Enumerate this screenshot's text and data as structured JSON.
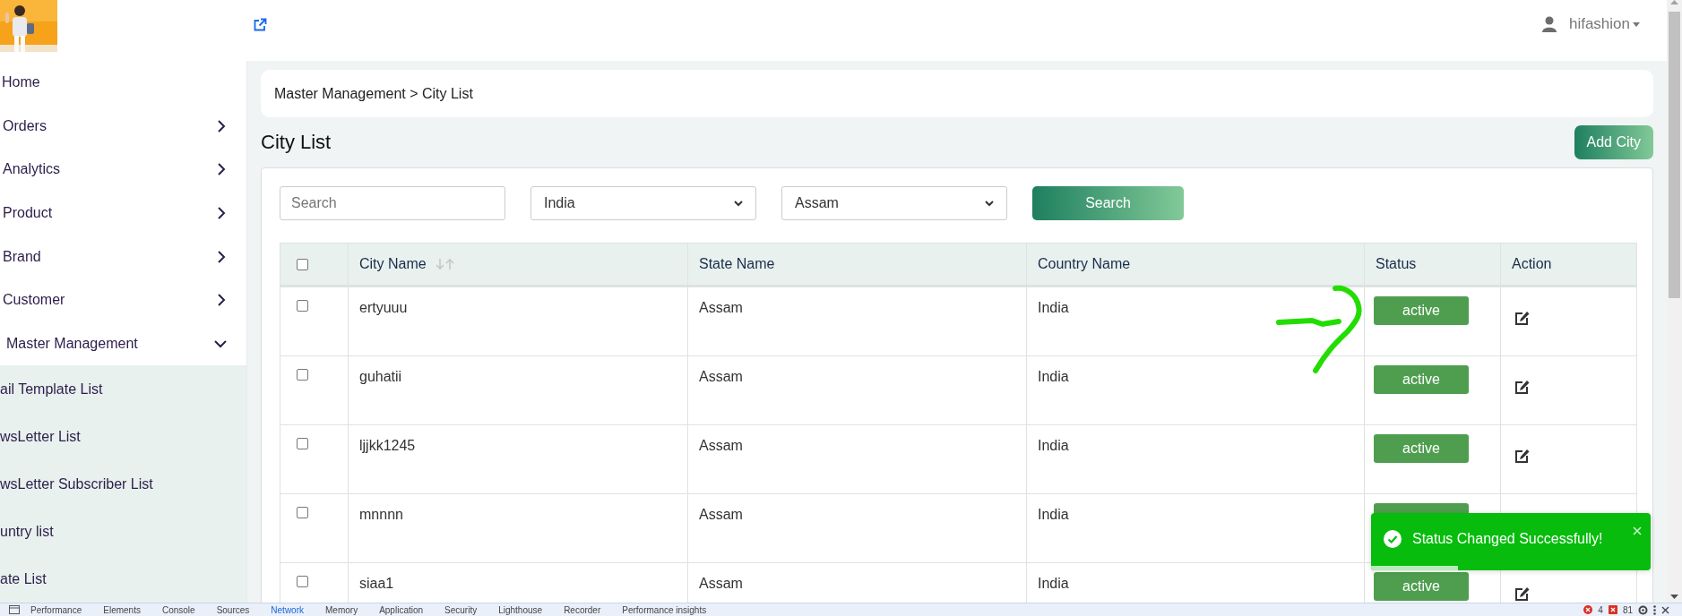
{
  "header": {
    "username": "hifashion"
  },
  "sidebar": {
    "items": [
      {
        "label": "Home",
        "kind": "link"
      },
      {
        "label": "Orders",
        "kind": "group",
        "expanded": false
      },
      {
        "label": "Analytics",
        "kind": "group",
        "expanded": false
      },
      {
        "label": "Product",
        "kind": "group",
        "expanded": false
      },
      {
        "label": "Brand",
        "kind": "group",
        "expanded": false
      },
      {
        "label": "Customer",
        "kind": "group",
        "expanded": false
      },
      {
        "label": "Master Management",
        "kind": "group",
        "expanded": true,
        "children": [
          {
            "label": "ail Template List"
          },
          {
            "label": "wsLetter List"
          },
          {
            "label": "wsLetter Subscriber List"
          },
          {
            "label": "untry list"
          },
          {
            "label": "ate List"
          }
        ]
      }
    ]
  },
  "breadcrumb": "Master Management > City List",
  "page_title": "City List",
  "add_button": "Add City",
  "filters": {
    "search_placeholder": "Search",
    "country": "India",
    "state": "Assam",
    "search_button": "Search"
  },
  "table": {
    "columns": [
      "City Name",
      "State Name",
      "Country Name",
      "Status",
      "Action"
    ],
    "select_all_checked": false,
    "rows": [
      {
        "checked": false,
        "city": "ertyuuu",
        "state": "Assam",
        "country": "India",
        "status": "active"
      },
      {
        "checked": false,
        "city": "guhatii",
        "state": "Assam",
        "country": "India",
        "status": "active"
      },
      {
        "checked": false,
        "city": "ljjkk1245",
        "state": "Assam",
        "country": "India",
        "status": "active"
      },
      {
        "checked": false,
        "city": "mnnnn",
        "state": "Assam",
        "country": "India"
      },
      {
        "checked": false,
        "city": "siaa1",
        "state": "Assam",
        "country": "India",
        "status": "active"
      }
    ]
  },
  "toast": {
    "message": "Status Changed Successfully!",
    "level": 0.31
  },
  "devtools": {
    "tabs": [
      {
        "label": "Performance",
        "selected": false
      },
      {
        "label": "Elements",
        "selected": false
      },
      {
        "label": "Console",
        "selected": false
      },
      {
        "label": "Sources",
        "selected": false
      },
      {
        "label": "Network",
        "selected": true
      },
      {
        "label": "Memory",
        "selected": false
      },
      {
        "label": "Application",
        "selected": false
      },
      {
        "label": "Security",
        "selected": false
      },
      {
        "label": "Lighthouse",
        "selected": false
      },
      {
        "label": "Recorder",
        "selected": false
      },
      {
        "label": "Performance insights",
        "selected": false
      }
    ],
    "errors": "4",
    "warnings": "81"
  }
}
